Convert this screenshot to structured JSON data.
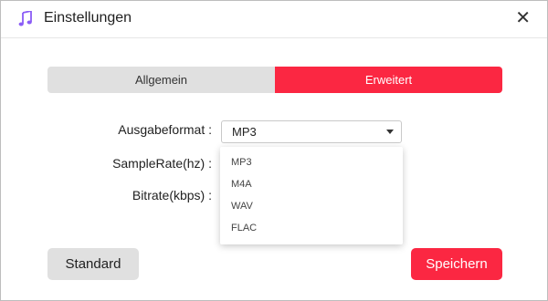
{
  "window": {
    "title": "Einstellungen",
    "icon": "music-note-icon",
    "close_label": "✕"
  },
  "tabs": [
    {
      "label": "Allgemein",
      "active": false
    },
    {
      "label": "Erweitert",
      "active": true
    }
  ],
  "form": {
    "format_label": "Ausgabeformat :",
    "samplerate_label": "SampleRate(hz) :",
    "bitrate_label": "Bitrate(kbps) :",
    "format_value": "MP3",
    "format_options": [
      "MP3",
      "M4A",
      "WAV",
      "FLAC"
    ]
  },
  "buttons": {
    "standard": "Standard",
    "save": "Speichern"
  },
  "colors": {
    "accent": "#fb2742",
    "tab_inactive": "#e0e0e0",
    "icon_purple": "#8a5cf6"
  }
}
